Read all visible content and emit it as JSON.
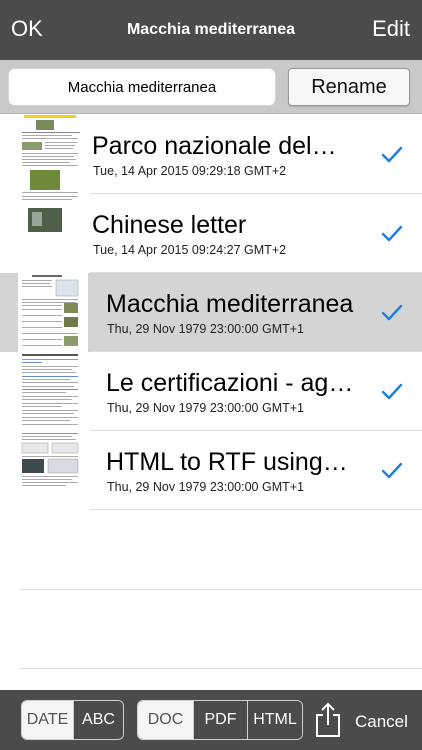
{
  "nav": {
    "ok_label": "OK",
    "title": "Macchia mediterranea",
    "edit_label": "Edit"
  },
  "rename_bar": {
    "name_value": "Macchia mediterranea",
    "rename_label": "Rename"
  },
  "documents": [
    {
      "title": "Parco nazionale del…",
      "date": "Tue, 14 Apr 2015 09:29:18 GMT+2",
      "checked": true,
      "selected": false
    },
    {
      "title": "Chinese letter",
      "date": "Tue, 14 Apr 2015 09:24:27 GMT+2",
      "checked": true,
      "selected": false
    },
    {
      "title": "Macchia mediterranea",
      "date": "Thu, 29 Nov 1979 23:00:00 GMT+1",
      "checked": true,
      "selected": true
    },
    {
      "title": "Le certificazioni - ag…",
      "date": "Thu, 29 Nov 1979 23:00:00 GMT+1",
      "checked": true,
      "selected": false
    },
    {
      "title": "HTML to RTF using…",
      "date": "Thu, 29 Nov 1979 23:00:00 GMT+1",
      "checked": true,
      "selected": false
    }
  ],
  "toolbar": {
    "sort": {
      "date_label": "DATE",
      "abc_label": "ABC",
      "active": "date"
    },
    "format": {
      "doc_label": "DOC",
      "pdf_label": "PDF",
      "html_label": "HTML",
      "active": "doc"
    },
    "cancel_label": "Cancel"
  },
  "colors": {
    "bar": "#4b4b4b",
    "checkmark": "#1a7fe0",
    "selected_row": "#d4d4d4"
  },
  "icons": {
    "check": "checkmark-icon",
    "share": "share-icon"
  }
}
